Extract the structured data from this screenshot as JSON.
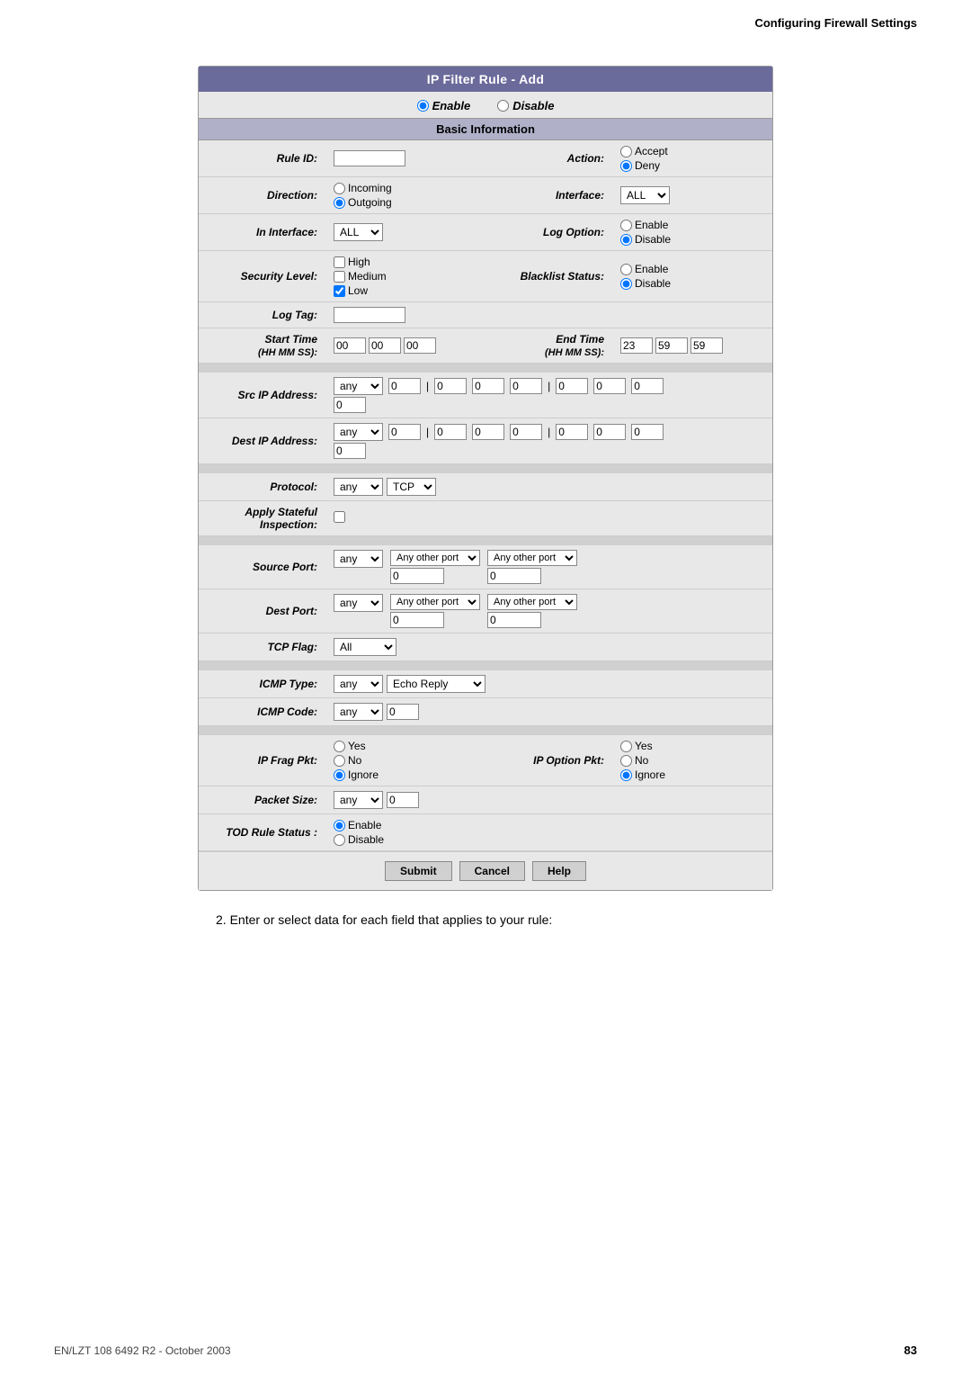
{
  "header": {
    "title": "Configuring Firewall Settings"
  },
  "form": {
    "title": "IP Filter Rule - Add",
    "enable_label": "Enable",
    "disable_label": "Disable",
    "basic_info_label": "Basic Information",
    "rule_id_label": "Rule ID:",
    "action_label": "Action:",
    "action_accept": "Accept",
    "action_deny": "Deny",
    "direction_label": "Direction:",
    "direction_incoming": "Incoming",
    "direction_outgoing": "Outgoing",
    "interface_label": "Interface:",
    "in_interface_label": "In Interface:",
    "log_option_label": "Log Option:",
    "log_enable": "Enable",
    "log_disable": "Disable",
    "security_level_label": "Security Level:",
    "security_high": "High",
    "security_medium": "Medium",
    "security_low": "Low",
    "blacklist_status_label": "Blacklist Status:",
    "blacklist_enable": "Enable",
    "blacklist_disable": "Disable",
    "log_tag_label": "Log Tag:",
    "start_time_label": "Start Time",
    "start_time_sub": "(HH MM SS):",
    "end_time_label": "End Time",
    "end_time_sub": "(HH MM SS):",
    "start_time_hh": "00",
    "start_time_mm": "00",
    "start_time_ss": "00",
    "end_time_hh": "23",
    "end_time_mm": "59",
    "end_time_ss": "59",
    "src_ip_label": "Src IP Address:",
    "dest_ip_label": "Dest IP Address:",
    "protocol_label": "Protocol:",
    "apply_stateful_label": "Apply Stateful",
    "apply_stateful_sub": "Inspection:",
    "source_port_label": "Source Port:",
    "dest_port_label": "Dest Port:",
    "tcp_flag_label": "TCP Flag:",
    "icmp_type_label": "ICMP Type:",
    "icmp_code_label": "ICMP Code:",
    "icmp_type_value": "Echo Reply",
    "ip_frag_label": "IP Frag Pkt:",
    "ip_frag_yes": "Yes",
    "ip_frag_no": "No",
    "ip_frag_ignore": "Ignore",
    "ip_option_label": "IP Option Pkt:",
    "ip_option_yes": "Yes",
    "ip_option_no": "No",
    "ip_option_ignore": "Ignore",
    "packet_size_label": "Packet Size:",
    "tod_rule_label": "TOD Rule Status :",
    "tod_enable": "Enable",
    "tod_disable": "Disable",
    "submit_label": "Submit",
    "cancel_label": "Cancel",
    "help_label": "Help",
    "any_other_port": "Any other port",
    "any_label": "any",
    "all_label": "All",
    "tcp_label": "TCP",
    "interface_all": "ALL"
  },
  "instruction": "2.   Enter or select data for each field that applies to your rule:",
  "footer": {
    "left": "EN/LZT 108 6492 R2 - October 2003",
    "page": "83"
  }
}
